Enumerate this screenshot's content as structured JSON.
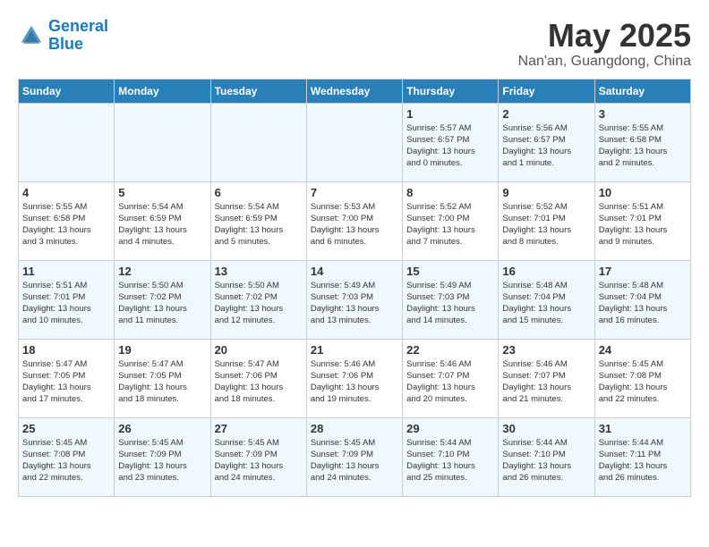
{
  "logo": {
    "line1": "General",
    "line2": "Blue"
  },
  "title": "May 2025",
  "location": "Nan'an, Guangdong, China",
  "days_of_week": [
    "Sunday",
    "Monday",
    "Tuesday",
    "Wednesday",
    "Thursday",
    "Friday",
    "Saturday"
  ],
  "weeks": [
    [
      {
        "day": "",
        "info": ""
      },
      {
        "day": "",
        "info": ""
      },
      {
        "day": "",
        "info": ""
      },
      {
        "day": "",
        "info": ""
      },
      {
        "day": "1",
        "info": "Sunrise: 5:57 AM\nSunset: 6:57 PM\nDaylight: 13 hours\nand 0 minutes."
      },
      {
        "day": "2",
        "info": "Sunrise: 5:56 AM\nSunset: 6:57 PM\nDaylight: 13 hours\nand 1 minute."
      },
      {
        "day": "3",
        "info": "Sunrise: 5:55 AM\nSunset: 6:58 PM\nDaylight: 13 hours\nand 2 minutes."
      }
    ],
    [
      {
        "day": "4",
        "info": "Sunrise: 5:55 AM\nSunset: 6:58 PM\nDaylight: 13 hours\nand 3 minutes."
      },
      {
        "day": "5",
        "info": "Sunrise: 5:54 AM\nSunset: 6:59 PM\nDaylight: 13 hours\nand 4 minutes."
      },
      {
        "day": "6",
        "info": "Sunrise: 5:54 AM\nSunset: 6:59 PM\nDaylight: 13 hours\nand 5 minutes."
      },
      {
        "day": "7",
        "info": "Sunrise: 5:53 AM\nSunset: 7:00 PM\nDaylight: 13 hours\nand 6 minutes."
      },
      {
        "day": "8",
        "info": "Sunrise: 5:52 AM\nSunset: 7:00 PM\nDaylight: 13 hours\nand 7 minutes."
      },
      {
        "day": "9",
        "info": "Sunrise: 5:52 AM\nSunset: 7:01 PM\nDaylight: 13 hours\nand 8 minutes."
      },
      {
        "day": "10",
        "info": "Sunrise: 5:51 AM\nSunset: 7:01 PM\nDaylight: 13 hours\nand 9 minutes."
      }
    ],
    [
      {
        "day": "11",
        "info": "Sunrise: 5:51 AM\nSunset: 7:01 PM\nDaylight: 13 hours\nand 10 minutes."
      },
      {
        "day": "12",
        "info": "Sunrise: 5:50 AM\nSunset: 7:02 PM\nDaylight: 13 hours\nand 11 minutes."
      },
      {
        "day": "13",
        "info": "Sunrise: 5:50 AM\nSunset: 7:02 PM\nDaylight: 13 hours\nand 12 minutes."
      },
      {
        "day": "14",
        "info": "Sunrise: 5:49 AM\nSunset: 7:03 PM\nDaylight: 13 hours\nand 13 minutes."
      },
      {
        "day": "15",
        "info": "Sunrise: 5:49 AM\nSunset: 7:03 PM\nDaylight: 13 hours\nand 14 minutes."
      },
      {
        "day": "16",
        "info": "Sunrise: 5:48 AM\nSunset: 7:04 PM\nDaylight: 13 hours\nand 15 minutes."
      },
      {
        "day": "17",
        "info": "Sunrise: 5:48 AM\nSunset: 7:04 PM\nDaylight: 13 hours\nand 16 minutes."
      }
    ],
    [
      {
        "day": "18",
        "info": "Sunrise: 5:47 AM\nSunset: 7:05 PM\nDaylight: 13 hours\nand 17 minutes."
      },
      {
        "day": "19",
        "info": "Sunrise: 5:47 AM\nSunset: 7:05 PM\nDaylight: 13 hours\nand 18 minutes."
      },
      {
        "day": "20",
        "info": "Sunrise: 5:47 AM\nSunset: 7:06 PM\nDaylight: 13 hours\nand 18 minutes."
      },
      {
        "day": "21",
        "info": "Sunrise: 5:46 AM\nSunset: 7:06 PM\nDaylight: 13 hours\nand 19 minutes."
      },
      {
        "day": "22",
        "info": "Sunrise: 5:46 AM\nSunset: 7:07 PM\nDaylight: 13 hours\nand 20 minutes."
      },
      {
        "day": "23",
        "info": "Sunrise: 5:46 AM\nSunset: 7:07 PM\nDaylight: 13 hours\nand 21 minutes."
      },
      {
        "day": "24",
        "info": "Sunrise: 5:45 AM\nSunset: 7:08 PM\nDaylight: 13 hours\nand 22 minutes."
      }
    ],
    [
      {
        "day": "25",
        "info": "Sunrise: 5:45 AM\nSunset: 7:08 PM\nDaylight: 13 hours\nand 22 minutes."
      },
      {
        "day": "26",
        "info": "Sunrise: 5:45 AM\nSunset: 7:09 PM\nDaylight: 13 hours\nand 23 minutes."
      },
      {
        "day": "27",
        "info": "Sunrise: 5:45 AM\nSunset: 7:09 PM\nDaylight: 13 hours\nand 24 minutes."
      },
      {
        "day": "28",
        "info": "Sunrise: 5:45 AM\nSunset: 7:09 PM\nDaylight: 13 hours\nand 24 minutes."
      },
      {
        "day": "29",
        "info": "Sunrise: 5:44 AM\nSunset: 7:10 PM\nDaylight: 13 hours\nand 25 minutes."
      },
      {
        "day": "30",
        "info": "Sunrise: 5:44 AM\nSunset: 7:10 PM\nDaylight: 13 hours\nand 26 minutes."
      },
      {
        "day": "31",
        "info": "Sunrise: 5:44 AM\nSunset: 7:11 PM\nDaylight: 13 hours\nand 26 minutes."
      }
    ]
  ]
}
